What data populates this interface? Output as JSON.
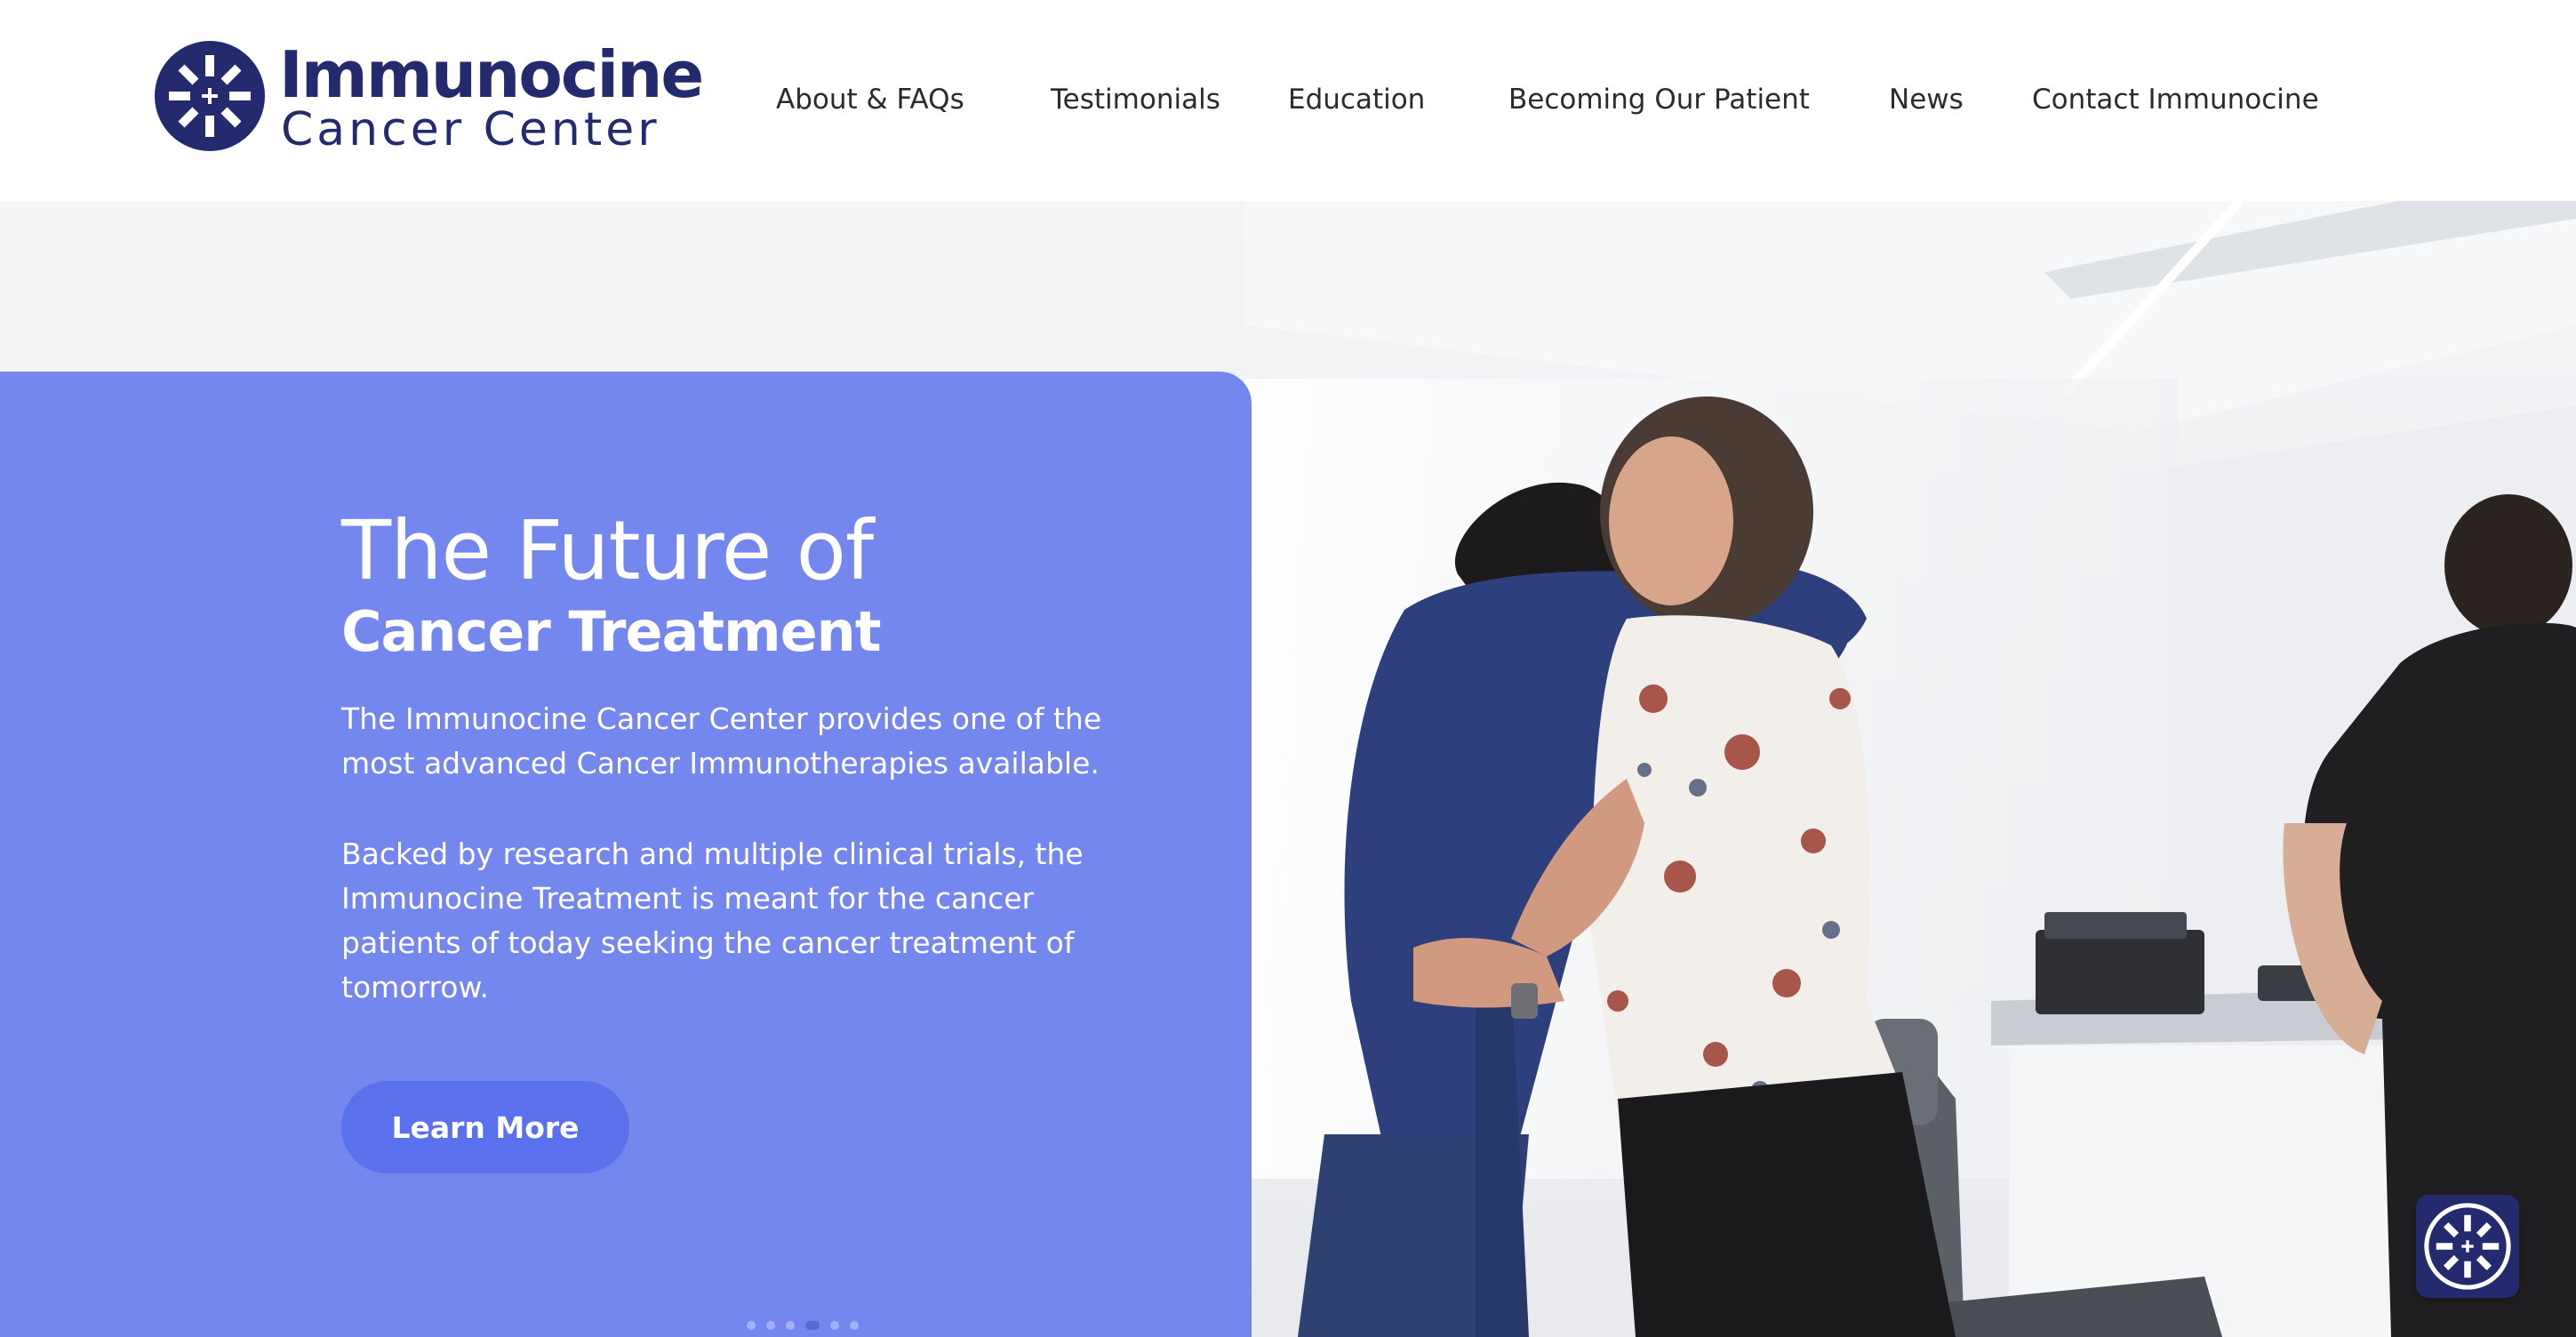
{
  "brand": {
    "name": "Immunocine",
    "subtitle": "Cancer Center",
    "logo_icon": "snowflake-cross-icon",
    "color": "#232a6e"
  },
  "nav": {
    "items": [
      {
        "label": "About & FAQs"
      },
      {
        "label": "Testimonials"
      },
      {
        "label": "Education"
      },
      {
        "label": "Becoming Our Patient"
      },
      {
        "label": "News"
      },
      {
        "label": "Contact Immunocine"
      }
    ]
  },
  "hero": {
    "title_line1": "The Future of",
    "title_line2": "Cancer Treatment",
    "paragraph1": "The Immunocine Cancer Center provides one of the most advanced Cancer Immunotherapies available.",
    "paragraph2": "Backed by research and multiple clinical trials, the Immunocine Treatment is meant for the cancer patients of today seeking the cancer treatment of tomorrow.",
    "cta_label": "Learn More",
    "panel_color": "#7487ee",
    "cta_color": "#5a70ec",
    "image_description_icon": "hugging-patient-photo"
  },
  "floating_badge": {
    "icon": "snowflake-cross-icon"
  }
}
